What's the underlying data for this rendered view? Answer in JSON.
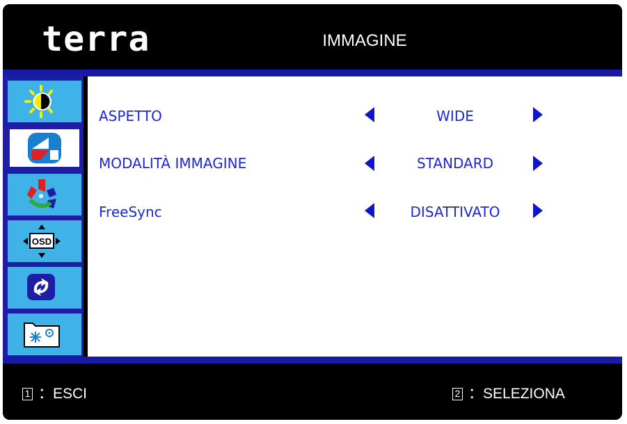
{
  "header": {
    "brand": "terra",
    "title": "IMMAGINE"
  },
  "sidebar": {
    "items": [
      {
        "icon": "brightness-contrast-icon",
        "active": false
      },
      {
        "icon": "image-icon",
        "active": true
      },
      {
        "icon": "color-icon",
        "active": false
      },
      {
        "icon": "osd-position-icon",
        "label": "OSD",
        "active": false
      },
      {
        "icon": "reset-icon",
        "active": false
      },
      {
        "icon": "extra-settings-icon",
        "active": false
      }
    ]
  },
  "menu": {
    "rows": [
      {
        "label": "ASPETTO",
        "value": "WIDE"
      },
      {
        "label": "MODALITÀ IMMAGINE",
        "value": "STANDARD"
      },
      {
        "label": "FreeSync",
        "value": "DISATTIVATO"
      }
    ]
  },
  "footer": {
    "exit_key": "1",
    "exit_label": "：ESCI",
    "select_key": "2",
    "select_label": "：SELEZIONA"
  },
  "colors": {
    "osd_background": "#000000",
    "accent_blue": "#1919a8",
    "tile_cyan": "#3fb2e8",
    "text_blue": "#1c28d6"
  }
}
